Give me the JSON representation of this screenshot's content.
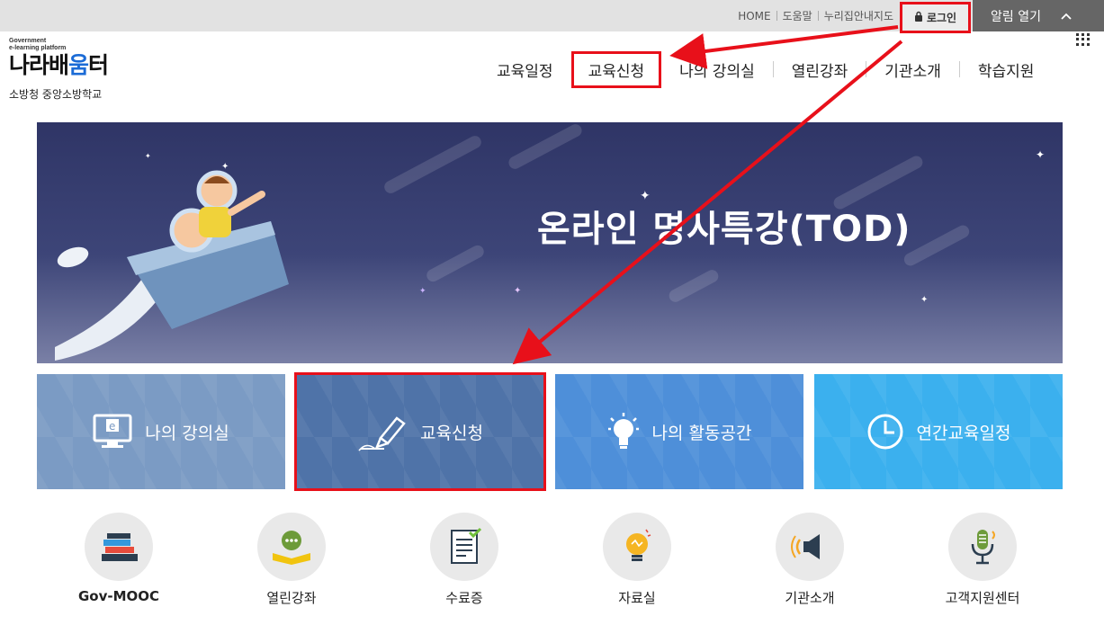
{
  "util": {
    "links": [
      "HOME",
      "도움말",
      "누리집안내지도"
    ],
    "login_label": "로그인",
    "alarm_label": "알림 열기"
  },
  "logo": {
    "small_line1": "Government",
    "small_line2": "e-learning platform",
    "main_prefix": "나라배",
    "main_highlight": "움",
    "main_suffix": "터",
    "sub": "소방청 중앙소방학교"
  },
  "nav": [
    "교육일정",
    "교육신청",
    "나의 강의실",
    "열린강좌",
    "기관소개",
    "학습지원"
  ],
  "banner": {
    "title": "온라인 명사특강(TOD)"
  },
  "tiles": [
    {
      "label": "나의 강의실",
      "icon": "monitor-e-icon"
    },
    {
      "label": "교육신청",
      "icon": "pen-nib-icon"
    },
    {
      "label": "나의 활동공간",
      "icon": "lightbulb-icon"
    },
    {
      "label": "연간교육일정",
      "icon": "clock-icon"
    }
  ],
  "quick": [
    {
      "label": "Gov-MOOC",
      "icon": "books-icon"
    },
    {
      "label": "열린강좌",
      "icon": "open-book-chat-icon"
    },
    {
      "label": "수료증",
      "icon": "certificate-icon"
    },
    {
      "label": "자료실",
      "icon": "lightbulb-icon"
    },
    {
      "label": "기관소개",
      "icon": "speaker-icon"
    },
    {
      "label": "고객지원센터",
      "icon": "microphone-icon"
    }
  ],
  "colors": {
    "highlight_red": "#e8101a",
    "tile1": "#7b9bc4",
    "tile2": "#4f73a8",
    "tile3": "#4e8fd9",
    "tile4": "#3bb0ee",
    "banner": "#2f3566"
  }
}
